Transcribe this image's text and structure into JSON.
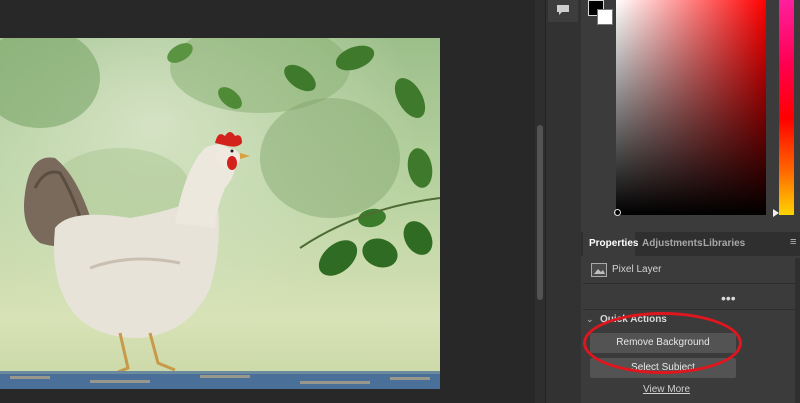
{
  "canvas": {
    "image_subject": "white hen standing on a weathered wooden rail with green leaves in the background"
  },
  "color_panel": {
    "foreground_color": "#000000",
    "background_color": "#ffffff",
    "selected_hue": "#ff0000"
  },
  "tabs": [
    {
      "label": "Properties",
      "active": true
    },
    {
      "label": "Adjustments",
      "active": false
    },
    {
      "label": "Libraries",
      "active": false
    }
  ],
  "properties": {
    "layer_type": "Pixel Layer",
    "more_label": "•••",
    "quick_actions": {
      "title": "Quick Actions",
      "remove_background_label": "Remove Background",
      "select_subject_label": "Select Subject",
      "view_more_label": "View More"
    }
  },
  "icons": {
    "comment": "comment-icon",
    "layer": "pixel-layer-icon",
    "panel_menu": "panel-menu-icon",
    "chevron": "chevron-down-icon"
  },
  "annotation": {
    "highlight_color": "#e0161e"
  }
}
